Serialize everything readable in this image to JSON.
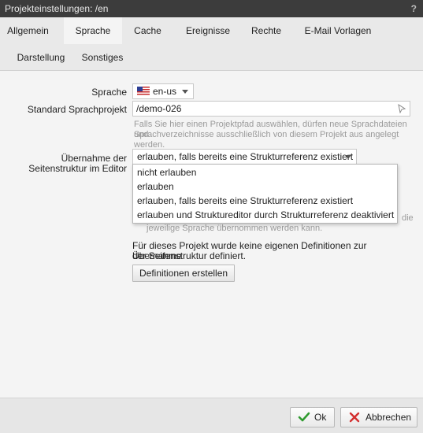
{
  "dialog": {
    "title": "Projekteinstellungen: /en",
    "help": "?"
  },
  "tabs": [
    {
      "label": "Allgemein"
    },
    {
      "label": "Sprache"
    },
    {
      "label": "Cache"
    },
    {
      "label": "Ereignisse"
    },
    {
      "label": "Rechte"
    },
    {
      "label": "E-Mail Vorlagen"
    },
    {
      "label": "Darstellung"
    },
    {
      "label": "Sonstiges"
    }
  ],
  "active_tab": "Sprache",
  "form": {
    "sprache_label": "Sprache",
    "sprache_value": "en-us",
    "standard_label": "Standard Sprachprojekt",
    "standard_value": "/demo-026",
    "standard_hint_1": "Falls Sie hier einen Projektpfad auswählen, dürfen neue Sprachdateien und",
    "standard_hint_2": "Sprachverzeichnisse ausschließlich von diesem Projekt aus angelegt werden.",
    "uebernahme_label_1": "Übernahme der",
    "uebernahme_label_2": "Seitenstruktur im Editor",
    "uebernahme_value": "erlauben, falls bereits eine Strukturreferenz existiert",
    "options": [
      "nicht erlauben",
      "erlauben",
      "erlauben, falls bereits eine Strukturreferenz existiert",
      "erlauben und Struktureditor durch Strukturreferenz deaktiviert"
    ],
    "hidden_hint_tail_1": "die",
    "hidden_hint_2": "jeweilige Sprache übernommen werden kann.",
    "definitions_text_1": "Für dieses Projekt wurde keine eigenen Definitionen zur Übernahme",
    "definitions_text_2": "der Seitenstruktur definiert.",
    "definitions_button": "Definitionen erstellen"
  },
  "footer": {
    "ok_label": "Ok",
    "cancel_label": "Abbrechen"
  },
  "colors": {
    "titlebar": "#3c3c3c",
    "ok_check": "#2e9a2e",
    "cancel_x": "#d32f2f",
    "hint": "#9a9a9a"
  },
  "icons": [
    "help-icon",
    "us-flag-icon",
    "chevron-down-icon",
    "cursor-arrow-icon",
    "check-icon",
    "close-icon"
  ]
}
